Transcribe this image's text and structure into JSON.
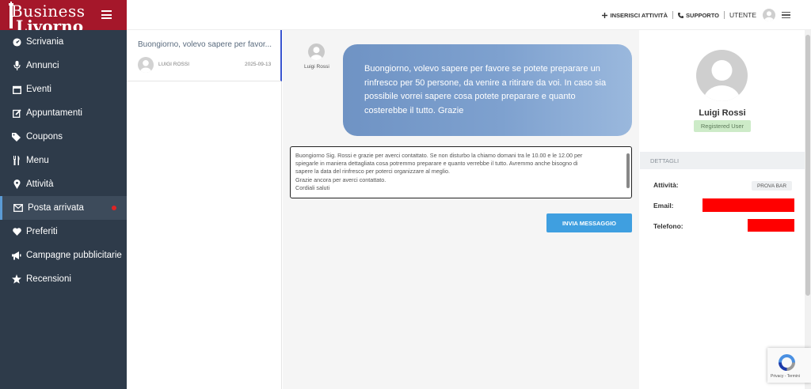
{
  "logo": {
    "line1": "Business",
    "line2": "Livorno"
  },
  "sidebar": {
    "items": [
      {
        "label": "Scrivania",
        "icon": "dashboard-icon"
      },
      {
        "label": "Annunci",
        "icon": "microphone-icon"
      },
      {
        "label": "Eventi",
        "icon": "calendar-icon"
      },
      {
        "label": "Appuntamenti",
        "icon": "edit-icon"
      },
      {
        "label": "Coupons",
        "icon": "tags-icon"
      },
      {
        "label": "Menu",
        "icon": "cutlery-icon"
      },
      {
        "label": "Attività",
        "icon": "map-marker-icon"
      },
      {
        "label": "Posta arrivata",
        "icon": "envelope-icon"
      },
      {
        "label": "Preferiti",
        "icon": "heart-icon"
      },
      {
        "label": "Campagne pubblicitarie",
        "icon": "bullhorn-icon"
      },
      {
        "label": "Recensioni",
        "icon": "star-icon"
      }
    ],
    "active_index": 7
  },
  "header": {
    "add_activity": "INSERISCI ATTIVITÀ",
    "support": "SUPPORTO",
    "user": "UTENTE"
  },
  "messages": [
    {
      "subject": "Buongiorno, volevo sapere per favor...",
      "sender": "LUIGI ROSSI",
      "date": "2025-09-13"
    }
  ],
  "chat": {
    "sender_name": "Luigi Rossi",
    "message": "Buongiorno, volevo sapere per favore se potete preparare un rinfresco per 50 persone, da venire a ritirare da voi. In caso sia possibile vorrei sapere cosa potete preparare e quanto costerebbe il tutto. Grazie",
    "reply_lines": [
      "Buongiorno Sig. Rossi e grazie per averci contattato. Se non disturbo la chiamo domani tra le 10.00 e le 12.00 per",
      "spiegarle in maniera dettagliata cosa potremmo preparare e quanto verrebbe il tutto. Avremmo anche bisogno di",
      "sapere la data del rinfresco per poterci organizzare al meglio.",
      "Grazie ancora per averci contattato.",
      "Cordiali saluti"
    ],
    "send_label": "INVIA MESSAGGIO"
  },
  "profile": {
    "name": "Luigi Rossi",
    "role": "Registered User",
    "details_title": "DETTAGLI",
    "activity_label": "Attività:",
    "activity_value": "PROVA BAR",
    "email_label": "Email:",
    "phone_label": "Telefono:"
  },
  "recaptcha": {
    "text": "Privacy - Termini"
  },
  "colors": {
    "sidebar_bg": "#2e3b4a",
    "logo_bg": "#a5172a",
    "accent_blue": "#3f9fe0",
    "redaction": "#ff0000",
    "notification_dot": "#e02424"
  }
}
